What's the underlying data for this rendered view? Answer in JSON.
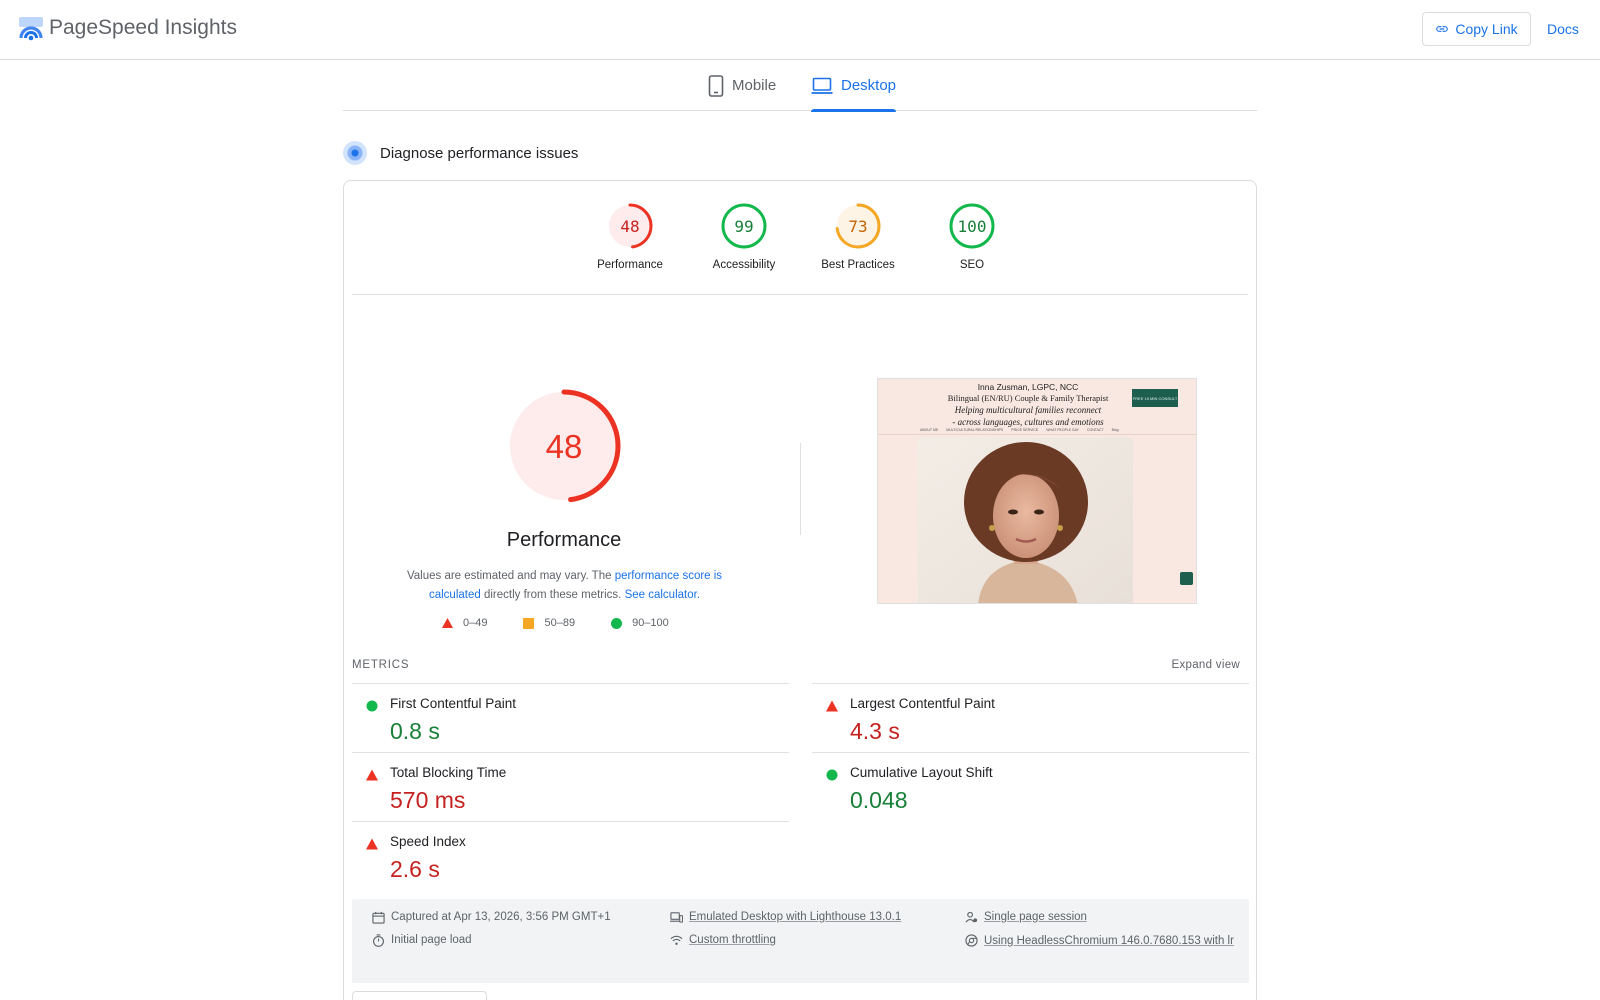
{
  "header": {
    "app_title": "PageSpeed Insights",
    "copy_link_label": "Copy Link",
    "docs_label": "Docs",
    "brand_color": "#1a73e8"
  },
  "tabs": [
    {
      "label": "Mobile",
      "icon": "smartphone-icon",
      "selected": false
    },
    {
      "label": "Desktop",
      "icon": "laptop-icon",
      "selected": true
    }
  ],
  "section": {
    "title": "Diagnose performance issues"
  },
  "categories": [
    {
      "label": "Performance",
      "score": "48",
      "fraction": 0.48,
      "status": "poor"
    },
    {
      "label": "Accessibility",
      "score": "99",
      "fraction": 0.99,
      "status": "good"
    },
    {
      "label": "Best Practices",
      "score": "73",
      "fraction": 0.73,
      "status": "average"
    },
    {
      "label": "SEO",
      "score": "100",
      "fraction": 1.0,
      "status": "good"
    }
  ],
  "colors": {
    "poor": "#eb3223",
    "poor_bg": "#fdeceb",
    "poor_text": "#c5221f",
    "average": "#f5a623",
    "average_bg": "#fef4e6",
    "average_text": "#c26401",
    "good": "#12b84c",
    "good_bg": "#ffffff",
    "good_text": "#188038"
  },
  "performance": {
    "score": "48",
    "fraction": 0.48,
    "label": "Performance",
    "desc_prefix": "Values are estimated and may vary. The ",
    "desc_link1": "performance score is calculated",
    "desc_mid": " directly from these metrics. ",
    "desc_link2": "See calculator.",
    "legend": [
      {
        "range": "0–49",
        "shape": "triangle",
        "color": "#eb3223"
      },
      {
        "range": "50–89",
        "shape": "square",
        "color": "#f5a623"
      },
      {
        "range": "90–100",
        "shape": "circle",
        "color": "#12b84c"
      }
    ]
  },
  "screenshot": {
    "name": "Inna Zusman, LGPC, NCC",
    "subtitle": "Bilingual (EN/RU) Couple & Family Therapist",
    "tagline1": "Helping multicultural families reconnect",
    "tagline2": "- across languages, cultures and emotions",
    "cta": "FREE 15 MIN CONSULT",
    "nav": [
      "ABOUT ME",
      "MULTICULTURAL RELATIONSHIPS",
      "PRICE SERVICE",
      "WHAT PEOPLE SAY",
      "CONTACT",
      "Blog"
    ]
  },
  "metrics": {
    "heading": "METRICS",
    "expand_label": "Expand view",
    "items": [
      {
        "title": "First Contentful Paint",
        "value": "0.8 s",
        "status": "good"
      },
      {
        "title": "Largest Contentful Paint",
        "value": "4.3 s",
        "status": "poor"
      },
      {
        "title": "Total Blocking Time",
        "value": "570 ms",
        "status": "poor"
      },
      {
        "title": "Cumulative Layout Shift",
        "value": "0.048",
        "status": "good"
      },
      {
        "title": "Speed Index",
        "value": "2.6 s",
        "status": "poor"
      }
    ]
  },
  "runtime": {
    "captured": "Captured at Apr 13, 2026, 3:56 PM GMT+1",
    "load": "Initial page load",
    "emulated": "Emulated Desktop with Lighthouse 13.0.1",
    "throttling": "Custom throttling",
    "session": "Single page session",
    "browser": "Using HeadlessChromium 146.0.7680.153 with lr"
  }
}
